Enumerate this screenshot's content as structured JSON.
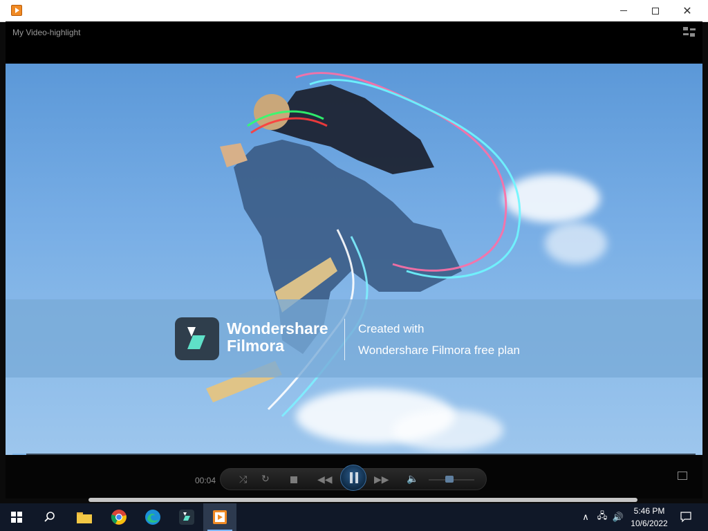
{
  "window": {
    "player_title": "My Video-highlight"
  },
  "icons": {
    "app": "media-player-icon",
    "minimize": "minimize-icon",
    "maximize": "maximize-icon",
    "close": "close-icon",
    "switch_view": "switch-view-icon",
    "shuffle": "shuffle-icon",
    "repeat": "repeat-icon",
    "stop": "stop-icon",
    "previous": "previous-icon",
    "pause": "pause-icon",
    "next": "next-icon",
    "volume": "volume-icon",
    "mini_player": "mini-player-icon"
  },
  "watermark": {
    "brand_line1": "Wondershare",
    "brand_line2": "Filmora",
    "caption_line1": "Created with",
    "caption_line2": "Wondershare Filmora free plan"
  },
  "playback": {
    "elapsed": "00:04",
    "progress": 0.02,
    "volume": 0.45,
    "state": "playing"
  },
  "taskbar": {
    "items": [
      "start",
      "search",
      "file-explorer",
      "chrome",
      "edge",
      "filmora",
      "media-player"
    ],
    "active": "media-player",
    "clock_time": "5:46 PM",
    "clock_date": "10/6/2022"
  },
  "colors": {
    "accent": "#7fb6e8",
    "taskbar": "#101828",
    "filmora_logo": "#2f3e4c",
    "filmora_mark": "#5fe0c8"
  }
}
